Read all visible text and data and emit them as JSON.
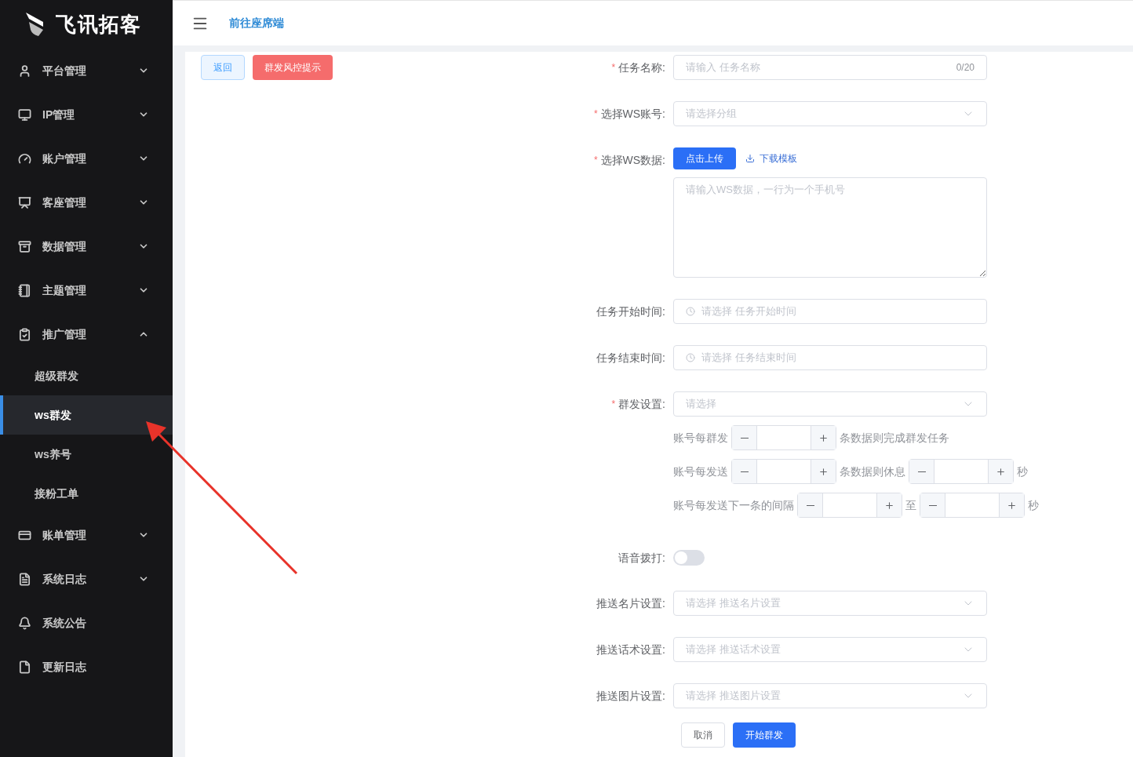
{
  "sidebar": {
    "logo": "飞讯拓客",
    "items": [
      {
        "label": "平台管理",
        "expanded": false
      },
      {
        "label": "IP管理",
        "expanded": false
      },
      {
        "label": "账户管理",
        "expanded": false
      },
      {
        "label": "客座管理",
        "expanded": false
      },
      {
        "label": "数据管理",
        "expanded": false
      },
      {
        "label": "主题管理",
        "expanded": false
      },
      {
        "label": "推广管理",
        "expanded": true,
        "children": [
          {
            "label": "超级群发",
            "selected": false
          },
          {
            "label": "ws群发",
            "selected": true
          },
          {
            "label": "ws养号",
            "selected": false
          },
          {
            "label": "接粉工单",
            "selected": false
          }
        ]
      },
      {
        "label": "账单管理",
        "expanded": false
      },
      {
        "label": "系统日志",
        "expanded": false
      },
      {
        "label": "系统公告"
      },
      {
        "label": "更新日志"
      }
    ]
  },
  "header": {
    "link": "前往座席端"
  },
  "toolbar": {
    "back": "返回",
    "risk": "群发风控提示"
  },
  "form": {
    "fields": [
      {
        "kind": "text",
        "label": "任务名称:",
        "required_mark": "*",
        "placeholder": "请输入 任务名称",
        "counter": "0/20"
      },
      {
        "kind": "select",
        "label": "选择WS账号:",
        "required_mark": "*",
        "placeholder": "请选择分组"
      },
      {
        "kind": "upload",
        "label": "选择WS数据:",
        "required_mark": "*",
        "button": "点击上传",
        "link": "下载模板",
        "placeholder": "请输入WS数据，一行为一个手机号"
      },
      {
        "kind": "date",
        "label": "任务开始时间:",
        "placeholder": "请选择 任务开始时间"
      },
      {
        "kind": "date",
        "label": "任务结束时间:",
        "placeholder": "请选择 任务结束时间"
      },
      {
        "kind": "select",
        "label": "群发设置:",
        "required_mark": "*",
        "placeholder": "请选择",
        "lines": [
          [
            {
              "kind": "text",
              "text": "账号每群发"
            },
            {
              "kind": "stepper"
            },
            {
              "kind": "text",
              "text": "条数据则完成群发任务"
            }
          ],
          [
            {
              "kind": "text",
              "text": "账号每发送"
            },
            {
              "kind": "stepper"
            },
            {
              "kind": "text",
              "text": "条数据则休息"
            },
            {
              "kind": "stepper"
            },
            {
              "kind": "text",
              "text": "秒"
            }
          ],
          [
            {
              "kind": "text",
              "text": "账号每发送下一条的间隔"
            },
            {
              "kind": "stepper"
            },
            {
              "kind": "text",
              "text": "至"
            },
            {
              "kind": "stepper"
            },
            {
              "kind": "text",
              "text": "秒"
            }
          ]
        ]
      },
      {
        "kind": "switch",
        "label": "语音拨打:",
        "on": false
      },
      {
        "kind": "select",
        "label": "推送名片设置:",
        "placeholder": "请选择 推送名片设置"
      },
      {
        "kind": "select",
        "label": "推送话术设置:",
        "placeholder": "请选择 推送话术设置"
      },
      {
        "kind": "select",
        "label": "推送图片设置:",
        "placeholder": "请选择 推送图片设置"
      }
    ],
    "cancel": "取消",
    "submit": "开始群发"
  }
}
